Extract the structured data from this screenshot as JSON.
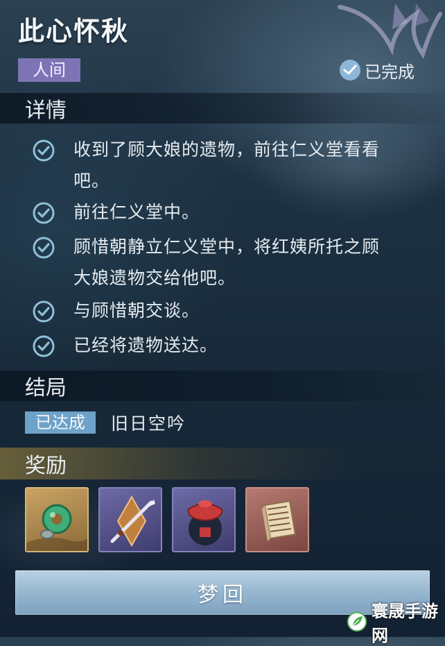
{
  "quest": {
    "title": "此心怀秋",
    "tag": "人间",
    "status": "已完成"
  },
  "details": {
    "heading": "详情",
    "tasks": [
      {
        "text_lines": [
          "收到了顾大娘的遗物，前往仁义堂看看",
          "吧。"
        ],
        "done": true
      },
      {
        "text_lines": [
          "前往仁义堂中。"
        ],
        "done": true
      },
      {
        "text_lines": [
          "顾惜朝静立仁义堂中，将红姨所托之顾",
          "大娘遗物交给他吧。"
        ],
        "done": true
      },
      {
        "text_lines": [
          "与顾惜朝交谈。"
        ],
        "done": true
      },
      {
        "text_lines": [
          "已经将遗物送达。"
        ],
        "done": true
      }
    ]
  },
  "ending": {
    "heading": "结局",
    "badge": "已达成",
    "name": "旧日空吟"
  },
  "rewards": {
    "heading": "奖励",
    "items": [
      {
        "icon": "jade-pendant-icon",
        "rarity": "gold"
      },
      {
        "icon": "dagger-icon",
        "rarity": "purple"
      },
      {
        "icon": "wine-jar-icon",
        "rarity": "purple"
      },
      {
        "icon": "book-icon",
        "rarity": "red"
      }
    ]
  },
  "action": {
    "button_label": "梦回"
  },
  "watermark": {
    "text": "寰晟手游网",
    "logo_icon": "leaf-logo-icon"
  },
  "colors": {
    "tag_purple": "#7d74b5",
    "badge_blue": "#6ea2c9",
    "check_teal": "#8fc0d8"
  }
}
